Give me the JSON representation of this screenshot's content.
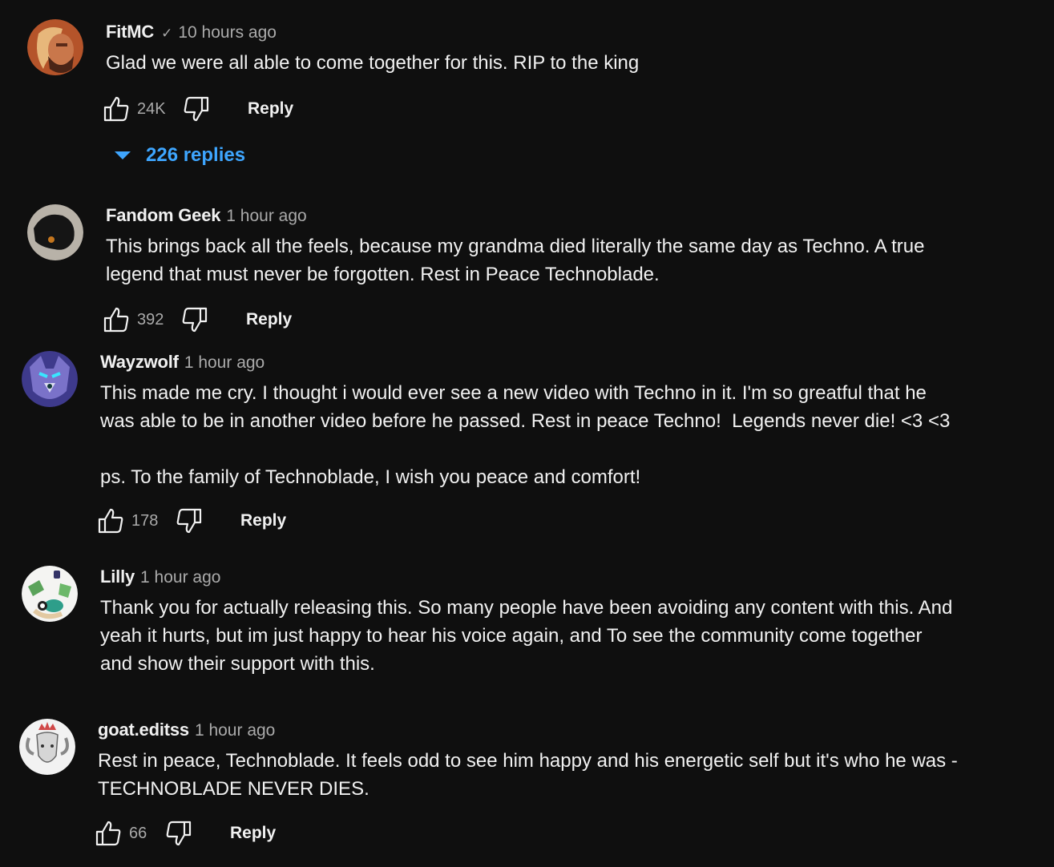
{
  "colors": {
    "background": "#0f0f0f",
    "text": "#f1f1f1",
    "muted": "#aaaaaa",
    "link": "#3ea6ff"
  },
  "reply_label": "Reply",
  "comments": [
    {
      "author": "FitMC",
      "verified": true,
      "time": "10 hours ago",
      "text": "Glad we were all able to come together for this. RIP to the king",
      "likes": "24K",
      "replies_label": "226 replies",
      "avatar": "avatar-bearded-man-orange"
    },
    {
      "author": "Fandom Geek",
      "verified": false,
      "time": "1 hour ago",
      "text": "This brings back all the feels, because my grandma died literally the same day as Techno. A true\nlegend that must never be forgotten. Rest in Peace Technoblade.",
      "likes": "392",
      "avatar": "avatar-black-dog"
    },
    {
      "author": "Wayzwolf",
      "verified": false,
      "time": "1 hour ago",
      "text": "This made me cry. I thought i would ever see a new video with Techno in it. I'm so greatful that he\nwas able to be in another video before he passed. Rest in peace Techno!  Legends never die! <3 <3\n\nps. To the family of Technoblade, I wish you peace and comfort!",
      "likes": "178",
      "avatar": "avatar-purple-wolf"
    },
    {
      "author": "Lilly",
      "verified": false,
      "time": "1 hour ago",
      "text": "Thank you for actually releasing this. So many people have been avoiding any content with this. And\nyeah it hurts, but im just happy to hear his voice again, and To see the community come together\nand show their support with this.",
      "likes": "",
      "avatar": "avatar-green-character"
    },
    {
      "author": "goat.editss",
      "verified": false,
      "time": "1 hour ago",
      "text": "Rest in peace, Technoblade. It feels odd to see him happy and his energetic self but it's who he was -\nTECHNOBLADE NEVER DIES.",
      "likes": "66",
      "avatar": "avatar-crowned-ram"
    }
  ]
}
